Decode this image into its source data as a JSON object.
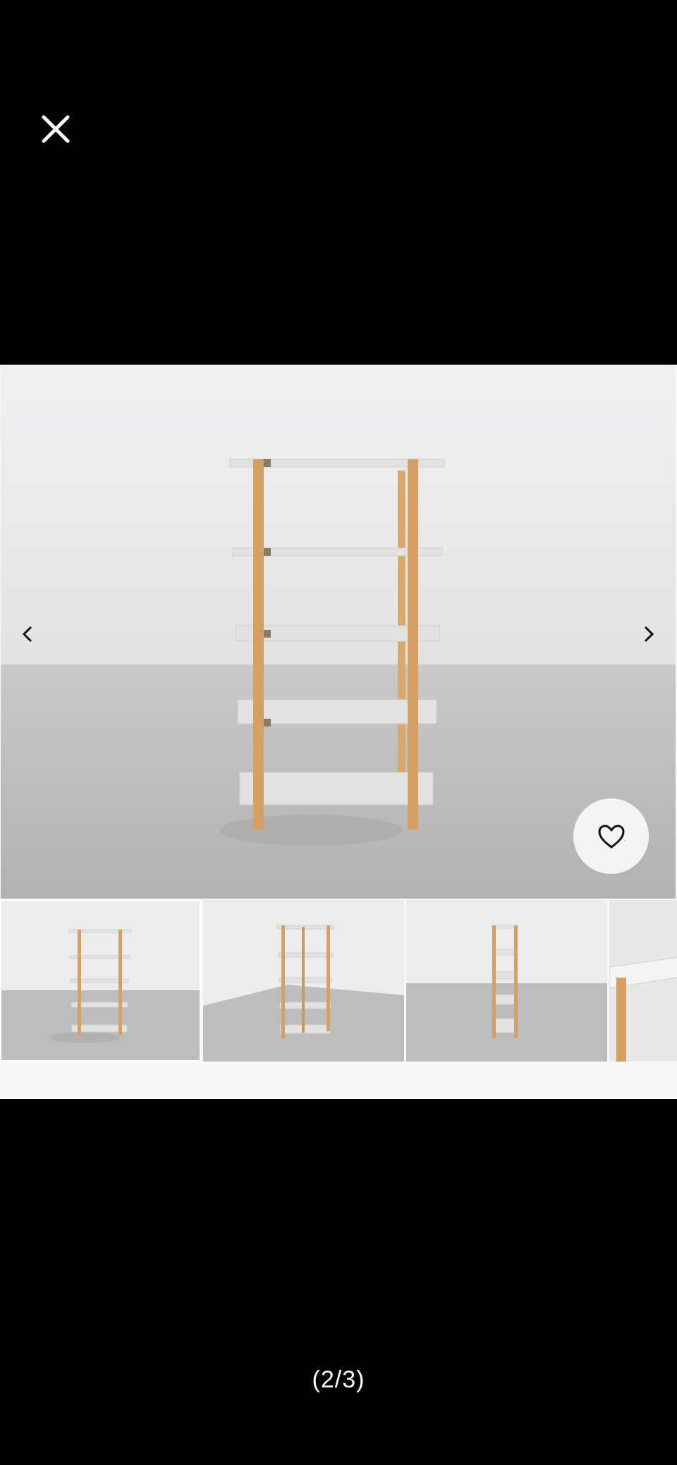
{
  "viewer": {
    "close_icon": "close-icon",
    "prev_icon": "chevron-left-icon",
    "next_icon": "chevron-right-icon",
    "favorite_icon": "heart-outline-icon",
    "counter": "(2/3)",
    "thumbnails": [
      {
        "id": "front-view",
        "selected": true
      },
      {
        "id": "angled-view",
        "selected": false
      },
      {
        "id": "side-view",
        "selected": false
      },
      {
        "id": "detail-view",
        "selected": false
      }
    ]
  },
  "colors": {
    "background": "#000000",
    "wall": "#ececec",
    "floor": "#b8b8b8",
    "wood": "#d9a96c",
    "shelf": "#e2e2e2"
  }
}
